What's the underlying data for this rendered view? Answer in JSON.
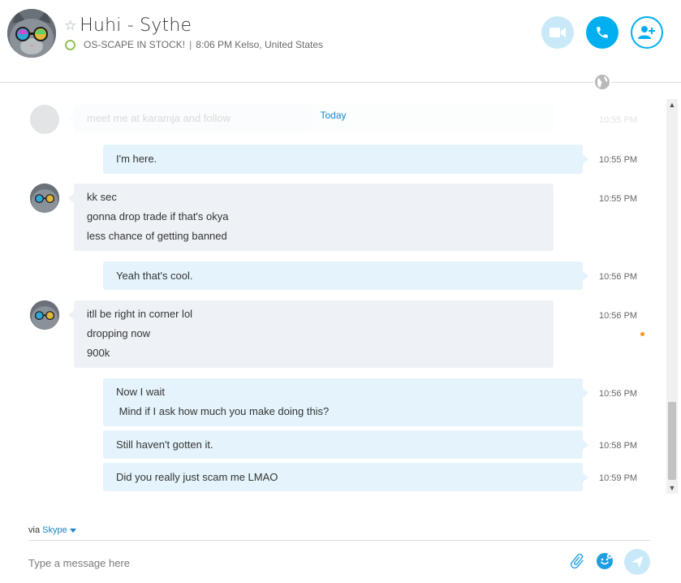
{
  "header": {
    "contact_name": "Huhi - Sythe",
    "mood": "OS-SCAPE IN STOCK!",
    "separator": "|",
    "local_time_location": "8:06 PM Kelso, United States",
    "icons": {
      "favorite": "star-outline-icon",
      "presence": "presence-online-icon",
      "video": "video-call-icon",
      "call": "phone-icon",
      "add": "add-people-icon",
      "translate": "globe-icon"
    },
    "colors": {
      "accent": "#00aff0",
      "video_disabled": "#c9e9f8",
      "presence": "#92c353"
    }
  },
  "chat": {
    "date_divider": "Today",
    "faded_message": {
      "text": "meet me at karamja and follow",
      "time": "10:55 PM"
    },
    "messages": [
      {
        "direction": "outgoing",
        "lines": [
          "I'm here."
        ],
        "time": "10:55 PM"
      },
      {
        "direction": "incoming",
        "lines": [
          "kk sec",
          "gonna drop trade if that's okya",
          "less chance of getting banned"
        ],
        "time": "10:55 PM"
      },
      {
        "direction": "outgoing",
        "lines": [
          "Yeah that's cool."
        ],
        "time": "10:56 PM"
      },
      {
        "direction": "incoming",
        "lines": [
          "itll be right in corner lol",
          "dropping now",
          "900k"
        ],
        "time": "10:56 PM"
      },
      {
        "direction": "outgoing",
        "lines": [
          "Now I wait",
          " Mind if I ask how much you make doing this?"
        ],
        "time": "10:56 PM"
      },
      {
        "direction": "outgoing",
        "lines": [
          "Still haven't gotten it."
        ],
        "time": "10:58 PM"
      },
      {
        "direction": "outgoing",
        "lines": [
          "Did you really just scam me LMAO"
        ],
        "time": "10:59 PM"
      }
    ],
    "colors": {
      "incoming_bubble": "#eef2f6",
      "outgoing_bubble": "#e5f4fc",
      "unread_dot": "#f7941e",
      "link": "#1a86c7"
    }
  },
  "footer": {
    "via_label": "via",
    "via_service": "Skype",
    "composer_placeholder": "Type a message here",
    "icons": {
      "attach": "paperclip-icon",
      "emoji": "emoticon-icon",
      "send": "send-icon"
    }
  }
}
